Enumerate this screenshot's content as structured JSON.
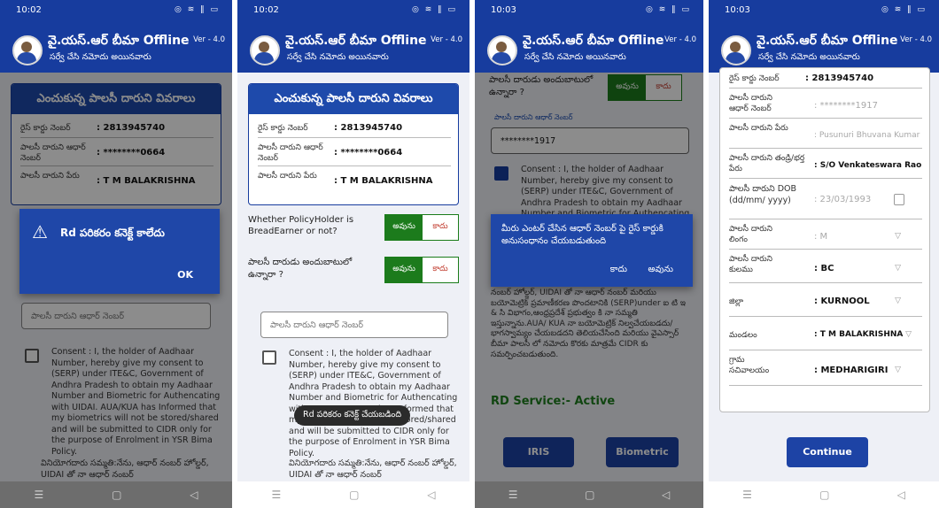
{
  "common": {
    "app_title": "వై.యస్.ఆర్ బీమా Offline",
    "app_subtitle": "సర్వే చేసి నమోదు అయినవారు",
    "version": "Ver - 4.0",
    "status_icons": "◎ ≋ ‖ ▭"
  },
  "screen1": {
    "time": "10:02",
    "card_title": "ఎంచుకున్న పాలసీ దారుని వివరాలు",
    "rice_card_label": "రైస్ కార్డు నెంబర్",
    "rice_card_value": ": 2813945740",
    "aadhaar_label": "పాలసీ దారుని ఆధార్ నెంబర్",
    "aadhaar_value": ": ********0664",
    "name_label": "పాలసీ దారుని పేరు",
    "name_value": ": T M BALAKRISHNA",
    "dialog_message": "Rd పరికరం కనెక్ట్ కాలేదు",
    "dialog_ok": "OK",
    "aadhaar_placeholder": "పాలసీ దారుని ఆధార్ నెంబర్",
    "consent_text": "Consent : I, the holder of Aadhaar Number, hereby give my consent to (SERP) under ITE&C, Government of Andhra Pradesh to obtain my Aadhaar Number and Biometric for Authencating with UIDAI. AUA/KUA has Informed that my biometrics will not be stored/shared and will be submitted to CIDR only for the purpose of Enrolment in YSR Bima Policy.",
    "consent_telugu": "వినియోగదారు సమ్మతి:నేను, ఆధార్ నంబర్ హోల్డర్, UIDAI తో నా ఆధార్ నంబర్"
  },
  "screen2": {
    "time": "10:02",
    "card_title": "ఎంచుకున్న పాలసీ దారుని వివరాలు",
    "rice_card_label": "రైస్ కార్డు నెంబర్",
    "rice_card_value": ": 2813945740",
    "aadhaar_label": "పాలసీ దారుని ఆధార్ నెంబర్",
    "aadhaar_value": ": ********0664",
    "name_label": "పాలసీ దారుని పేరు",
    "name_value": ": T M BALAKRISHNA",
    "q1": "Whether PolicyHolder is BreadEarner or not?",
    "q2": "పాలసీ దారుడు అందుబాటులో ఉన్నారా ?",
    "yes": "అవును",
    "no": "కాదు",
    "aadhaar_placeholder": "పాలసీ దారుని ఆధార్ నెంబర్",
    "consent_text": "Consent : I, the holder of Aadhaar Number, hereby give my consent to (SERP) under ITE&C, Government of Andhra Pradesh to obtain my Aadhaar Number and Biometric for Authencating with UIDAI. AUA/KUA has Informed that my biometrics will not be stored/shared and will be submitted to CIDR only for the purpose of Enrolment in YSR Bima Policy.",
    "consent_telugu": "వినియోగదారు సమ్మతి:నేను, ఆధార్ నంబర్ హోల్డర్, UIDAI తో నా ఆధార్ నంబర్",
    "toast": "Rd పరికరం కనెక్ట్ చేయబడింది"
  },
  "screen3": {
    "time": "10:03",
    "q2": "పాలసీ దారుడు అందుబాటులో ఉన్నారా ?",
    "yes": "అవును",
    "no": "కాదు",
    "aadhaar_field_label": "పాలసీ దారుని ఆధార్ నెంబర్",
    "aadhaar_value": "********1917",
    "consent_text": "Consent : I, the holder of Aadhaar Number, hereby give my consent to (SERP) under ITE&C, Government of Andhra Pradesh to obtain my Aadhaar Number and Biometric for Authencating",
    "consent_telugu": "నంబర్ హోల్డర్, UIDAI తో నా ఆధార్ నంబర్ మరియు బయోమెట్రిక్ ప్రమాణీకరణ పొందటానికి (SERP)under ఐ టి ఇ & సి విభాగం,ఆంధ్రప్రదేశ్ ప్రభుత్వం కి నా సమ్మతి ఇస్తున్నాను.AUA/ KUA నా బయోమెట్రిక్ నిల్వచేయబడదు/ భాగస్వామ్యం చేయబడదని తెలియచేసింది మరియు వైఎస్సార్ బీమా పాలసీ లో నమోదు కొరకు మాత్రమే CIDR కు సమర్పించబడుతుంది.",
    "dialog_message": "మీరు ఎంటర్ చేసిన ఆధార్ నెంబర్ పై రైస్ కార్డుకి అనుసంధానం చేయబడుతుంది",
    "dialog_no": "కాదు",
    "dialog_yes": "అవును",
    "rd_service_label": "RD Service:- Active",
    "iris_button": "IRIS",
    "biometric_button": "Biometric"
  },
  "screen4": {
    "time": "10:03",
    "rows": [
      {
        "label": "రైస్ కార్డు నెంబర్",
        "value": ": 2813945740",
        "light": false
      },
      {
        "label": "పాలసీ దారుని ఆధార్ నెంబర్",
        "value": ": ********1917",
        "light": true
      },
      {
        "label": "పాలసీ దారుని పేరు",
        "value": ": Pusunuri Bhuvana Kumar",
        "light": true
      },
      {
        "label": "పాలసీ దారుని తండ్రి/భర్త పేరు",
        "value": ": S/O Venkateswara Rao",
        "light": false
      },
      {
        "label": "పాలసీ దారుని DOB (dd/mm/ yyyy)",
        "value": ": 23/03/1993",
        "light": true
      },
      {
        "label": "పాలసీ దారుని లింగం",
        "value": ": M",
        "light": true
      },
      {
        "label": "పాలసీ దారుని కులము",
        "value": ": BC",
        "light": false
      },
      {
        "label": "జిల్లా",
        "value": ": KURNOOL",
        "light": false
      },
      {
        "label": "మండలం",
        "value": ": T M BALAKRISHNA",
        "light": false
      },
      {
        "label": "గ్రామ సచివాలయం",
        "value": ": MEDHARIGIRI",
        "light": false
      }
    ],
    "continue_button": "Continue"
  }
}
